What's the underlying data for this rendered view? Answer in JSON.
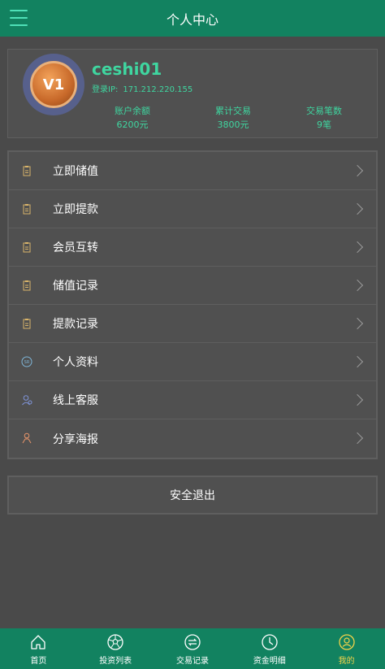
{
  "header": {
    "title": "个人中心",
    "menu_icon": "hamburger-menu-icon"
  },
  "profile": {
    "avatar_badge": "V1",
    "username": "ceshi01",
    "login_ip_label": "登录IP:",
    "login_ip": "171.212.220.155",
    "stats": [
      {
        "label": "账户余额",
        "value": "6200元"
      },
      {
        "label": "累计交易",
        "value": "3800元"
      },
      {
        "label": "交易笔数",
        "value": "9笔"
      }
    ]
  },
  "menu": {
    "items": [
      {
        "label": "立即储值",
        "icon": "clipboard-icon"
      },
      {
        "label": "立即提款",
        "icon": "clipboard-icon"
      },
      {
        "label": "会员互转",
        "icon": "clipboard-icon"
      },
      {
        "label": "储值记录",
        "icon": "clipboard-icon"
      },
      {
        "label": "提款记录",
        "icon": "clipboard-icon"
      },
      {
        "label": "个人资料",
        "icon": "profile-card-icon"
      },
      {
        "label": "线上客服",
        "icon": "support-agent-icon"
      },
      {
        "label": "分享海报",
        "icon": "share-person-icon"
      }
    ]
  },
  "logout_label": "安全退出",
  "tabbar": {
    "tabs": [
      {
        "label": "首页",
        "icon": "home-icon"
      },
      {
        "label": "投资列表",
        "icon": "football-icon"
      },
      {
        "label": "交易记录",
        "icon": "exchange-icon"
      },
      {
        "label": "资金明细",
        "icon": "clock-icon"
      },
      {
        "label": "我的",
        "icon": "user-icon"
      }
    ],
    "active_color": "#f2d34a"
  },
  "colors": {
    "brand": "#128260",
    "accent": "#3fd6a0",
    "background": "#4a4a4a"
  }
}
